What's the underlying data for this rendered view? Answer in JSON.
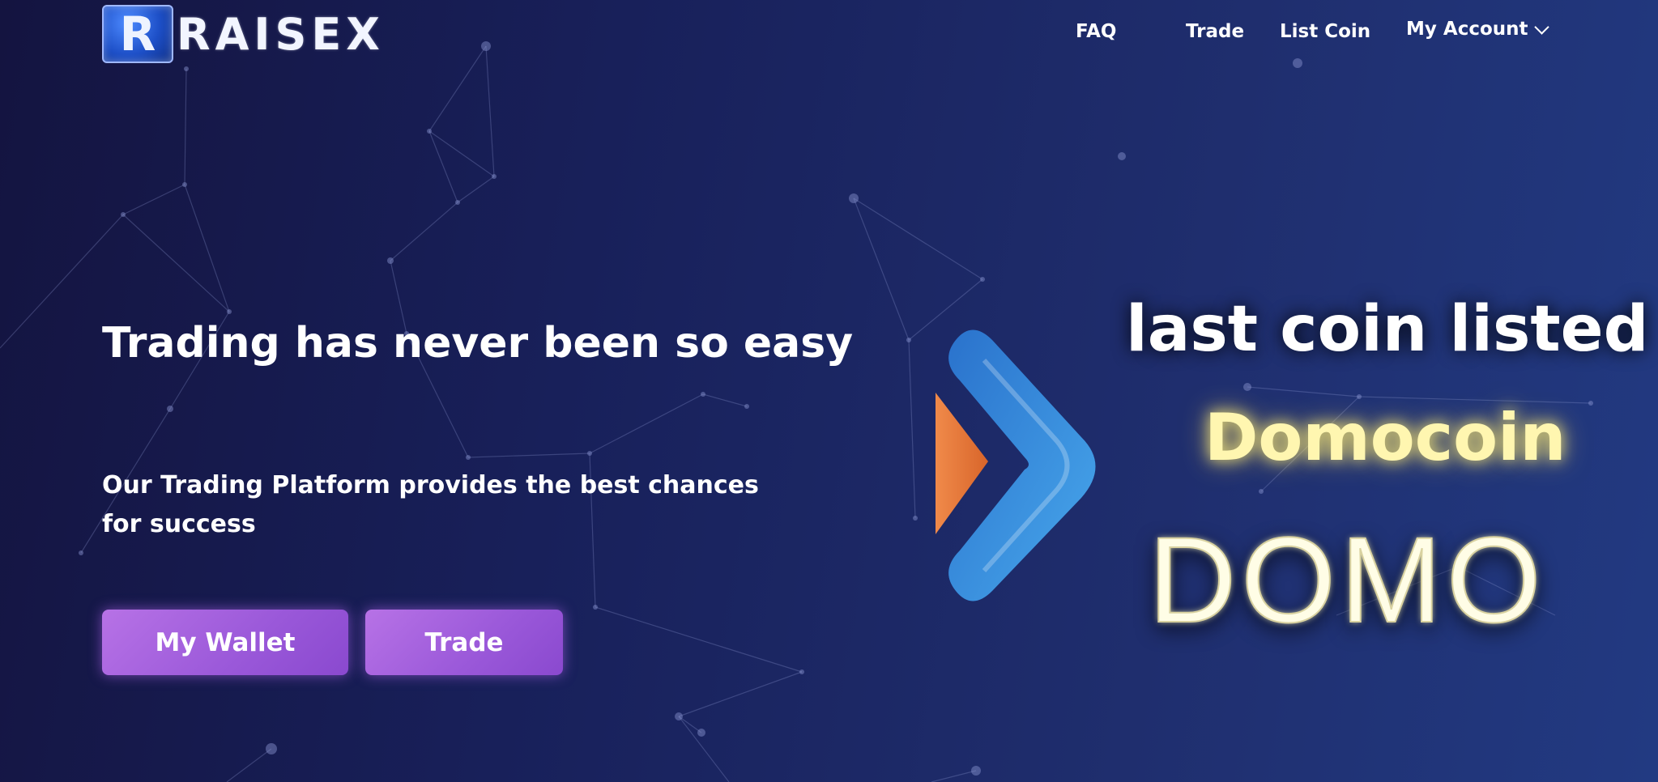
{
  "brand": {
    "logo_letter": "R",
    "logo_text": "RAISEX"
  },
  "nav": {
    "faq": "FAQ",
    "trade": "Trade",
    "list_coin": "List Coin",
    "my_account": "My Account"
  },
  "hero": {
    "title": "Trading has never been so easy",
    "subtitle": "Our Trading Platform provides the best chances for success",
    "wallet_button": "My Wallet",
    "trade_button": "Trade"
  },
  "promo": {
    "line1": "last coin listed",
    "coin_name": "Domocoin",
    "ticker": "DOMO",
    "accent_colors": {
      "blue": "#3c8be0",
      "orange": "#e8743a",
      "gold_glow": "#fff6b0"
    }
  },
  "colors": {
    "button": "#a463dd",
    "background": "#1a215f"
  }
}
